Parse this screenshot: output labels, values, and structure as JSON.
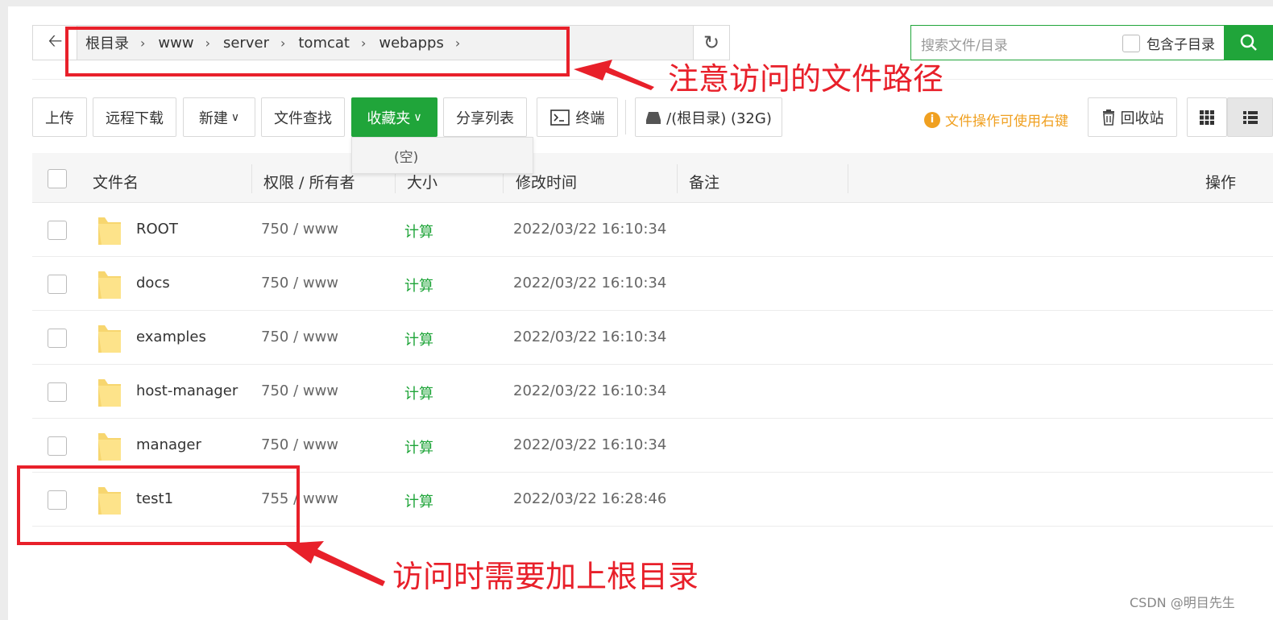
{
  "breadcrumb": [
    "根目录",
    "www",
    "server",
    "tomcat",
    "webapps"
  ],
  "search": {
    "placeholder": "搜索文件/目录",
    "subdir_label": "包含子目录"
  },
  "toolbar": {
    "upload": "上传",
    "remote_download": "远程下载",
    "new": "新建",
    "file_search": "文件查找",
    "favorites": "收藏夹",
    "share_list": "分享列表",
    "terminal": "终端",
    "disk": "/(根目录) (32G)",
    "tip": "文件操作可使用右键",
    "recycle": "回收站"
  },
  "favorites_dropdown": {
    "empty": "(空)"
  },
  "table": {
    "headers": {
      "name": "文件名",
      "perm": "权限 / 所有者",
      "size": "大小",
      "mtime": "修改时间",
      "note": "备注",
      "action": "操作"
    },
    "rows": [
      {
        "name": "ROOT",
        "perm": "750 / www",
        "size": "计算",
        "mtime": "2022/03/22 16:10:34"
      },
      {
        "name": "docs",
        "perm": "750 / www",
        "size": "计算",
        "mtime": "2022/03/22 16:10:34"
      },
      {
        "name": "examples",
        "perm": "750 / www",
        "size": "计算",
        "mtime": "2022/03/22 16:10:34"
      },
      {
        "name": "host-manager",
        "perm": "750 / www",
        "size": "计算",
        "mtime": "2022/03/22 16:10:34"
      },
      {
        "name": "manager",
        "perm": "750 / www",
        "size": "计算",
        "mtime": "2022/03/22 16:10:34"
      },
      {
        "name": "test1",
        "perm": "755 / www",
        "size": "计算",
        "mtime": "2022/03/22 16:28:46"
      }
    ]
  },
  "annotations": {
    "path_note": "注意访问的文件路径",
    "root_note": "访问时需要加上根目录"
  },
  "watermark": "CSDN @明目先生",
  "colors": {
    "accent": "#20a53a",
    "annotation": "#e8202a",
    "tip": "#f0a020"
  }
}
